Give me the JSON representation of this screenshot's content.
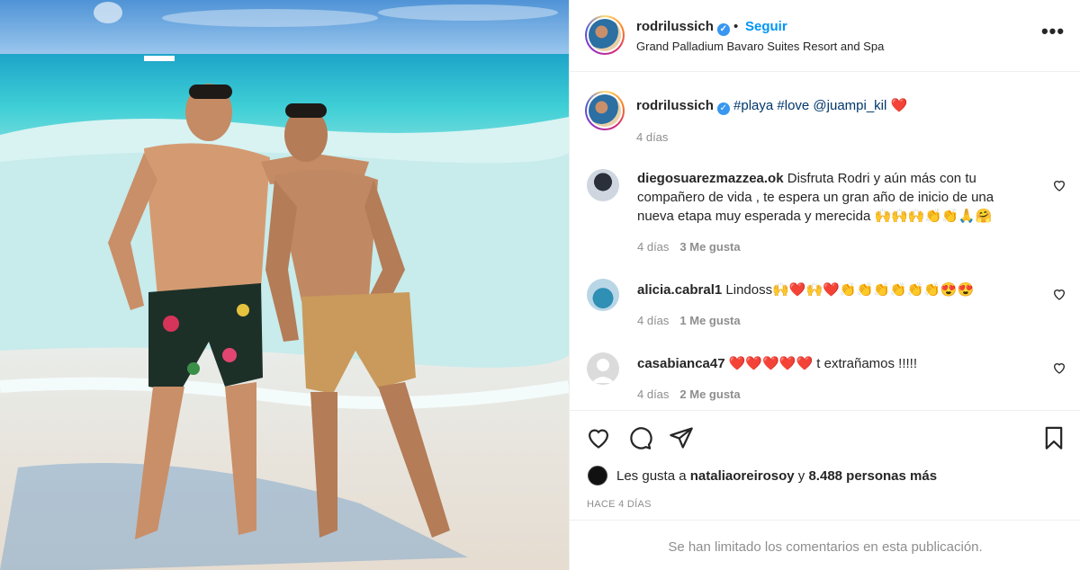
{
  "header": {
    "username": "rodrilussich",
    "verified_mark": "✓",
    "separator": "•",
    "follow_label": "Seguir",
    "location": "Grand Palladium Bavaro Suites Resort and Spa",
    "more_label": "•••"
  },
  "caption": {
    "username": "rodrilussich",
    "tags": "#playa #love @juampi_kil",
    "heart": "❤️",
    "time": "4 días"
  },
  "comments": [
    {
      "username": "diegosuarezmazzea.ok",
      "text": "Disfruta Rodri y aún más con tu compañero de vida , te espera un gran año de inicio de una nueva etapa muy esperada y merecida 🙌🙌🙌👏👏🙏🤗",
      "time": "4 días",
      "likes": "3 Me gusta"
    },
    {
      "username": "alicia.cabral1",
      "text": "Lindoss🙌❤️🙌❤️👏👏👏👏👏👏😍😍",
      "time": "4 días",
      "likes": "1 Me gusta"
    },
    {
      "username": "casabianca47",
      "text": "❤️❤️❤️❤️❤️ t extrañamos !!!!!",
      "time": "4 días",
      "likes": "2 Me gusta"
    }
  ],
  "likes": {
    "prefix": "Les gusta a",
    "user": "nataliaoreirosoy",
    "joiner": "y",
    "others": "8.488 personas más"
  },
  "post_time": "HACE 4 DÍAS",
  "comments_limited": "Se han limitado los comentarios en esta publicación.",
  "colors": {
    "accent": "#0095f6",
    "verified": "#3897f0",
    "heart": "#ed4956",
    "muted": "#8e8e8e"
  }
}
